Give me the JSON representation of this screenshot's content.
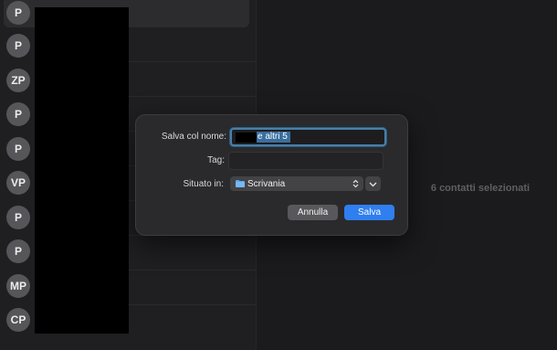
{
  "contacts": [
    {
      "initials": "P"
    },
    {
      "initials": "P"
    },
    {
      "initials": "ZP"
    },
    {
      "initials": "P"
    },
    {
      "initials": "P"
    },
    {
      "initials": "VP"
    },
    {
      "initials": "P"
    },
    {
      "initials": "P"
    },
    {
      "initials": "MP"
    },
    {
      "initials": "CP"
    }
  ],
  "detail": {
    "selection_text": "6 contatti selezionati"
  },
  "save_dialog": {
    "name_label": "Salva col nome:",
    "name_value": " e altri 5",
    "tag_label": "Tag:",
    "tag_value": "",
    "location_label": "Situato in:",
    "location_value": "Scrivania",
    "location_icon": "folder-icon",
    "cancel_label": "Annulla",
    "save_label": "Salva"
  },
  "colors": {
    "accent": "#2f7ff0",
    "avatar": "#56565a",
    "dialog_bg": "#2a2a2c",
    "window_bg": "#1b1b1d"
  }
}
